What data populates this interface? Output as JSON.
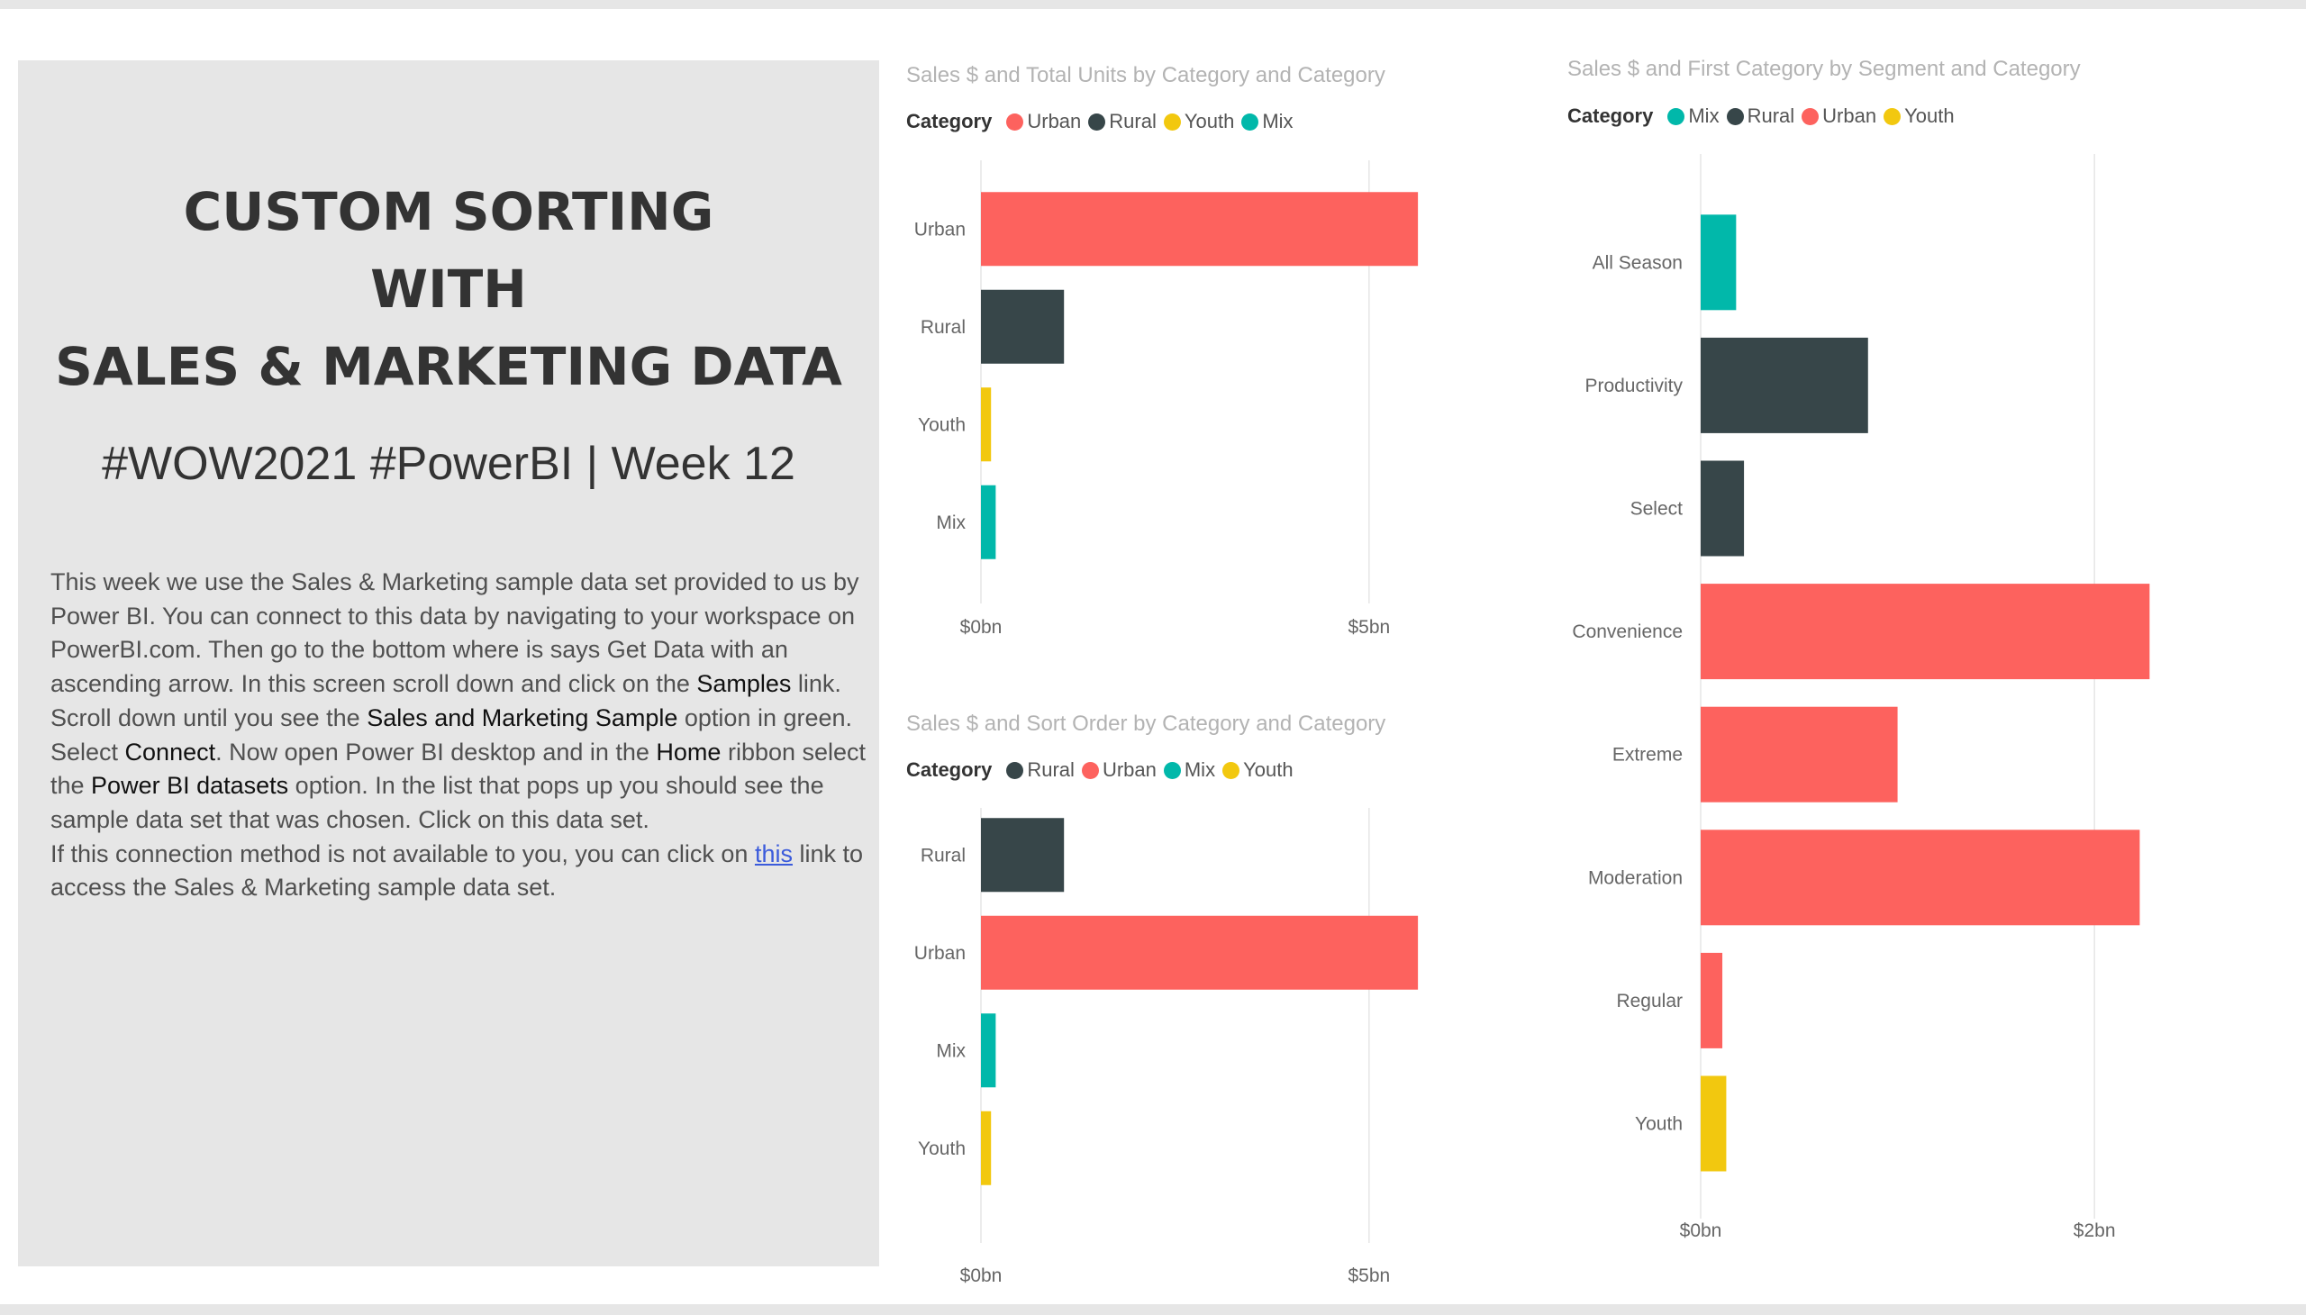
{
  "panel": {
    "title_lines": [
      "CUSTOM SORTING",
      "WITH",
      "SALES & MARKETING DATA"
    ],
    "subtitle": "#WOW2021 #PowerBI | Week 12",
    "desc": {
      "p1": "This week we use the Sales & Marketing sample data set provided to us by Power BI. You can connect to this data by navigating to your workspace on PowerBI.com. Then go to the bottom where is says Get Data with an ascending arrow. In this screen scroll down and click on the ",
      "samples": "Samples",
      "p2": " link. Scroll down until you see the ",
      "sales_sample": "Sales and Marketing Sample",
      "p3": " option in green. Select ",
      "connect": "Connect",
      "p4": ". Now open Power BI desktop and in the ",
      "home": "Home",
      "p5": " ribbon select the ",
      "datasets": "Power BI datasets",
      "p6": " option. In the list that pops up you should see the sample data set that was chosen. Click on this data set.",
      "p7": "If this connection method is not available to you, you can click on ",
      "link_text": "this",
      "p8": " link to access the Sales & Marketing sample data set."
    }
  },
  "colors": {
    "Urban": "#fd625e",
    "Rural": "#374649",
    "Youth": "#f2c80f",
    "Mix": "#01b8aa",
    "axis_text": "#666666",
    "gridline": "#e6e6e6"
  },
  "chart_data": [
    {
      "type": "bar",
      "orientation": "horizontal",
      "title": "Sales $ and Total Units by Category and Category",
      "legend_title": "Category",
      "legend": [
        "Urban",
        "Rural",
        "Youth",
        "Mix"
      ],
      "categories": [
        "Urban",
        "Rural",
        "Youth",
        "Mix"
      ],
      "values": [
        5.63,
        1.07,
        0.13,
        0.19
      ],
      "unit": "bn",
      "xlim": [
        0,
        6
      ],
      "ticks": [
        0,
        5
      ],
      "tick_labels": [
        "$0bn",
        "$5bn"
      ],
      "grid": true
    },
    {
      "type": "bar",
      "orientation": "horizontal",
      "title": "Sales $ and Sort Order by Category and Category",
      "legend_title": "Category",
      "legend": [
        "Rural",
        "Urban",
        "Mix",
        "Youth"
      ],
      "categories": [
        "Rural",
        "Urban",
        "Mix",
        "Youth"
      ],
      "values": [
        1.07,
        5.63,
        0.19,
        0.13
      ],
      "unit": "bn",
      "xlim": [
        0,
        6
      ],
      "ticks": [
        0,
        5
      ],
      "tick_labels": [
        "$0bn",
        "$5bn"
      ],
      "grid": true
    },
    {
      "type": "bar",
      "orientation": "horizontal",
      "title": "Sales $ and First Category by Segment and Category",
      "legend_title": "Category",
      "legend": [
        "Mix",
        "Rural",
        "Urban",
        "Youth"
      ],
      "categories": [
        "All Season",
        "Productivity",
        "Select",
        "Convenience",
        "Extreme",
        "Moderation",
        "Regular",
        "Youth"
      ],
      "values": [
        0.18,
        0.85,
        0.22,
        2.28,
        1.0,
        2.23,
        0.11,
        0.13
      ],
      "bar_category": [
        "Mix",
        "Rural",
        "Rural",
        "Urban",
        "Urban",
        "Urban",
        "Urban",
        "Youth"
      ],
      "unit": "bn",
      "xlim": [
        0,
        2.8
      ],
      "ticks": [
        0,
        2
      ],
      "tick_labels": [
        "$0bn",
        "$2bn"
      ],
      "grid": true
    }
  ]
}
